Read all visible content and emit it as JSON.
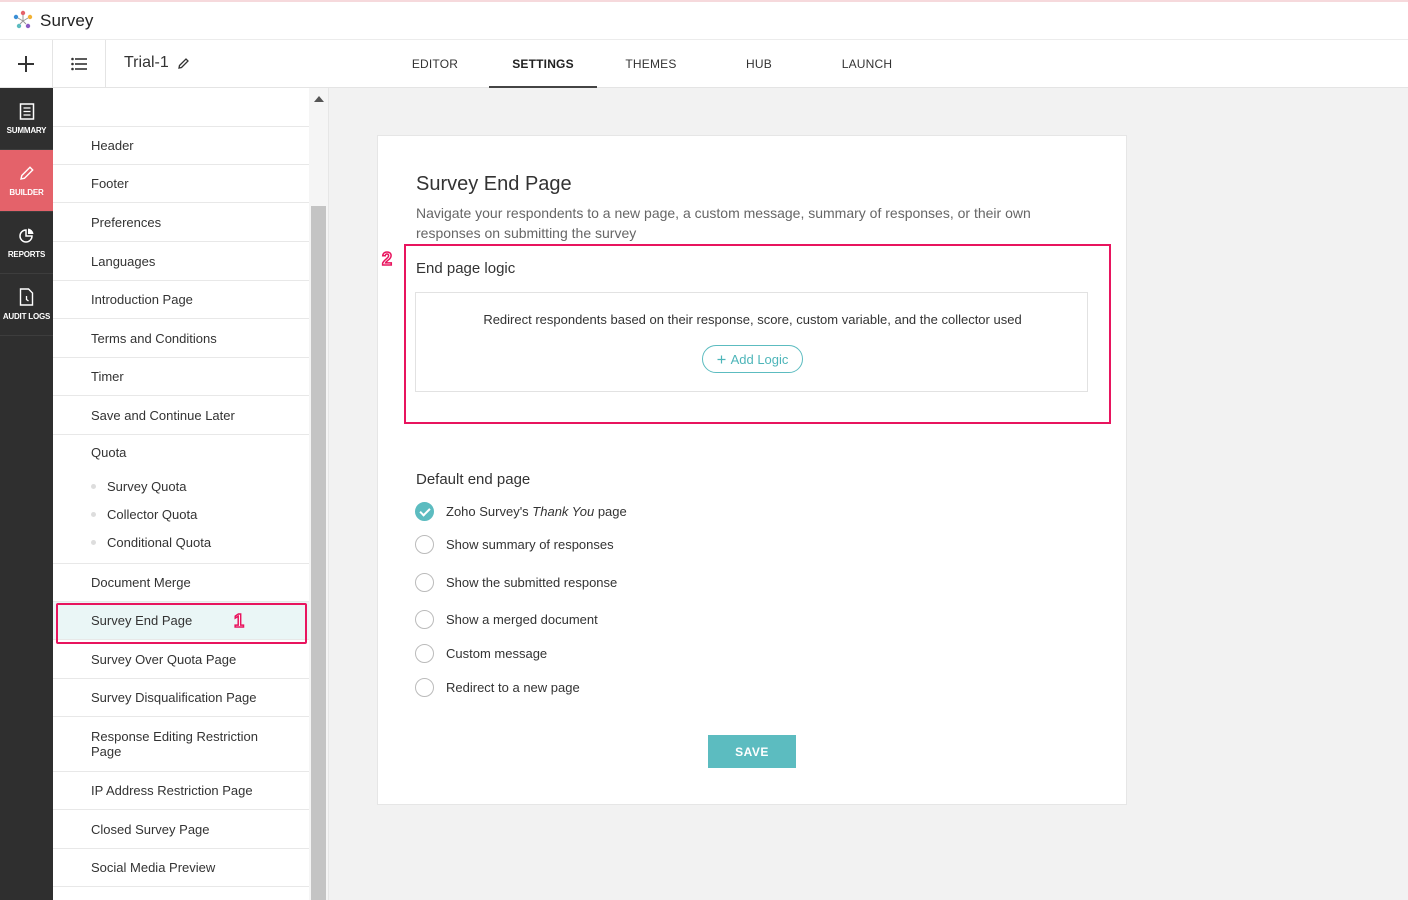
{
  "app": {
    "title": "Survey"
  },
  "toolbar": {
    "survey_name": "Trial-1",
    "tabs": [
      {
        "label": "EDITOR"
      },
      {
        "label": "SETTINGS"
      },
      {
        "label": "THEMES"
      },
      {
        "label": "HUB"
      },
      {
        "label": "LAUNCH"
      }
    ]
  },
  "left_nav": [
    {
      "label": "SUMMARY",
      "icon": "summary-icon"
    },
    {
      "label": "BUILDER",
      "icon": "pencil-icon"
    },
    {
      "label": "REPORTS",
      "icon": "pie-chart-icon"
    },
    {
      "label": "AUDIT LOGS",
      "icon": "audit-log-icon"
    }
  ],
  "settings_list": {
    "items": [
      {
        "label": "Header"
      },
      {
        "label": "Footer"
      },
      {
        "label": "Preferences"
      },
      {
        "label": "Languages"
      },
      {
        "label": "Introduction Page"
      },
      {
        "label": "Terms and Conditions"
      },
      {
        "label": "Timer"
      },
      {
        "label": "Save and Continue Later"
      },
      {
        "label": "Quota"
      },
      {
        "label": "Document Merge"
      },
      {
        "label": "Survey End Page"
      },
      {
        "label": "Survey Over Quota Page"
      },
      {
        "label": "Survey Disqualification Page"
      },
      {
        "label": "Response Editing Restriction Page"
      },
      {
        "label": "IP Address Restriction Page"
      },
      {
        "label": "Closed Survey Page"
      },
      {
        "label": "Social Media Preview"
      }
    ],
    "quota_sub": [
      {
        "label": "Survey Quota"
      },
      {
        "label": "Collector Quota"
      },
      {
        "label": "Conditional Quota"
      }
    ]
  },
  "annotations": {
    "one": "1",
    "two": "2"
  },
  "page": {
    "title": "Survey End Page",
    "description": "Navigate your respondents to a new page, a custom message, summary of responses, or their own responses on submitting the survey",
    "end_page_logic": {
      "title": "End page logic",
      "text": "Redirect respondents based on their response, score, custom variable, and the collector used",
      "add_logic_label": "Add Logic"
    },
    "default_end_page": {
      "title": "Default end page",
      "options": [
        {
          "prefix": "Zoho Survey's ",
          "italic": "Thank You",
          "suffix": " page",
          "checked": true
        },
        {
          "label": "Show summary of responses",
          "checked": false
        },
        {
          "label": "Show the submitted response",
          "checked": false
        },
        {
          "label": "Show a merged document",
          "checked": false
        },
        {
          "label": "Custom message",
          "checked": false
        },
        {
          "label": "Redirect to a new page",
          "checked": false
        }
      ]
    },
    "save_label": "SAVE"
  },
  "colors": {
    "accent": "#5cbcc0",
    "builder_active": "#e4626a",
    "highlight": "#e8145e"
  }
}
